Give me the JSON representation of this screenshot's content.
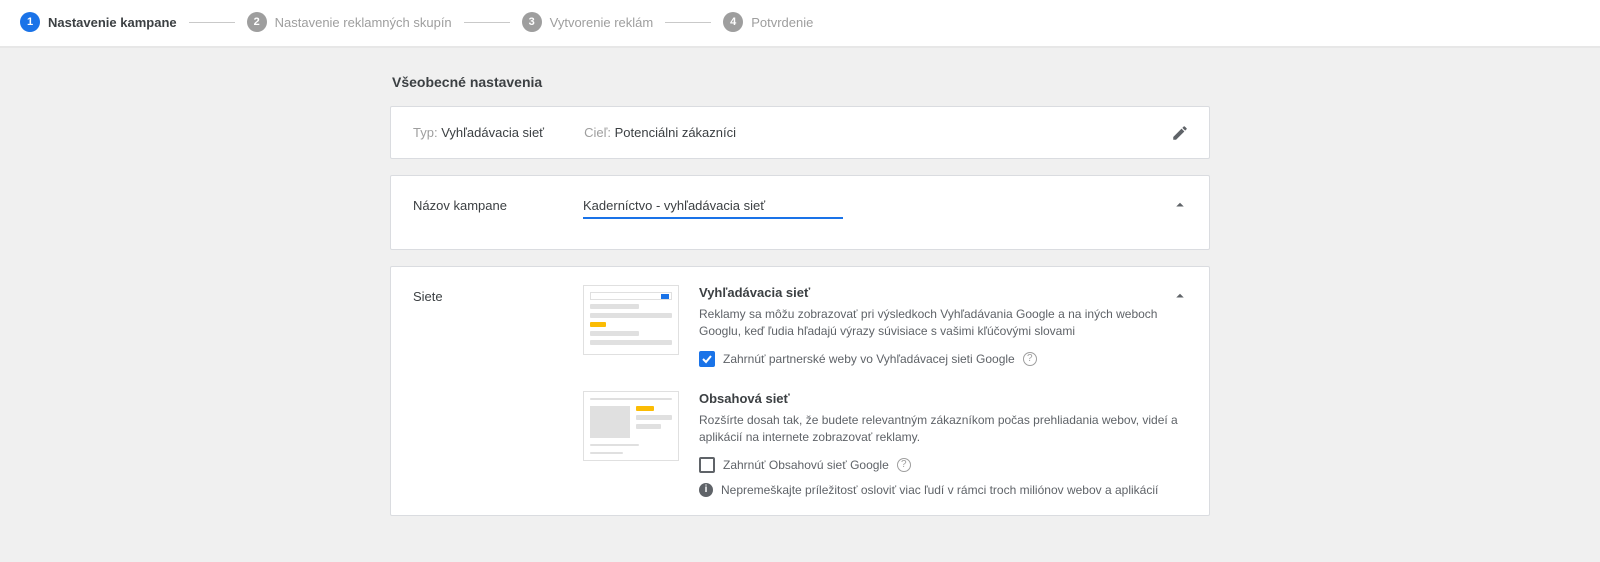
{
  "stepper": {
    "steps": [
      {
        "num": "1",
        "label": "Nastavenie kampane",
        "active": true
      },
      {
        "num": "2",
        "label": "Nastavenie reklamných skupín",
        "active": false
      },
      {
        "num": "3",
        "label": "Vytvorenie reklám",
        "active": false
      },
      {
        "num": "4",
        "label": "Potvrdenie",
        "active": false
      }
    ]
  },
  "section_title": "Všeobecné nastavenia",
  "type_card": {
    "type_label": "Typ:",
    "type_value": "Vyhľadávacia sieť",
    "goal_label": "Cieľ:",
    "goal_value": "Potenciálni zákazníci"
  },
  "name_card": {
    "label": "Názov kampane",
    "value": "Kaderníctvo - vyhľadávacia sieť"
  },
  "networks_card": {
    "label": "Siete",
    "search": {
      "title": "Vyhľadávacia sieť",
      "desc": "Reklamy sa môžu zobrazovať pri výsledkoch Vyhľadávania Google a na iných weboch Googlu, keď ľudia hľadajú výrazy súvisiace s vašimi kľúčovými slovami",
      "checkbox_label": "Zahrnúť partnerské weby vo Vyhľadávacej sieti Google",
      "checked": true
    },
    "display": {
      "title": "Obsahová sieť",
      "desc": "Rozšírte dosah tak, že budete relevantným zákazníkom počas prehliadania webov, videí a aplikácií na internete zobrazovať reklamy.",
      "checkbox_label": "Zahrnúť Obsahovú sieť Google",
      "checked": false,
      "info": "Nepremeškajte príležitosť osloviť viac ľudí v rámci troch miliónov webov a aplikácií"
    }
  }
}
